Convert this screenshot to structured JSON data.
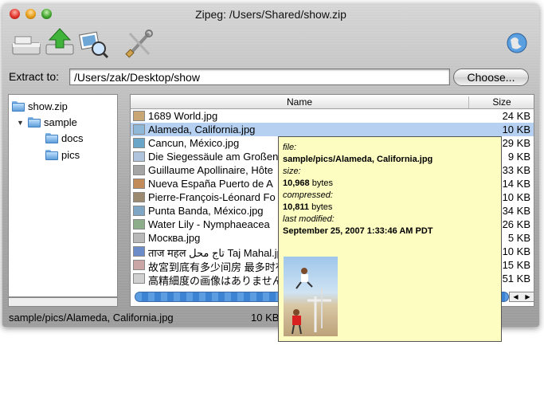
{
  "window": {
    "title": "Zipeg: /Users/Shared/show.zip"
  },
  "toolbar": {
    "buttons": [
      "drive-icon",
      "extract-up-icon",
      "preview-photos-icon",
      "tools-icon",
      "globe-icon"
    ]
  },
  "extract": {
    "label": "Extract to:",
    "path": "/Users/zak/Desktop/show",
    "choose_label": "Choose..."
  },
  "tree": {
    "items": [
      {
        "label": "show.zip",
        "level": 0,
        "expanded": false
      },
      {
        "label": "sample",
        "level": 1,
        "expanded": true
      },
      {
        "label": "docs",
        "level": 2
      },
      {
        "label": "pics",
        "level": 2
      }
    ]
  },
  "table": {
    "headers": {
      "name": "Name",
      "size": "Size"
    },
    "rows": [
      {
        "name": "1689 World.jpg",
        "size": "24 KB"
      },
      {
        "name": "Alameda, California.jpg",
        "size": "10 KB",
        "selected": true
      },
      {
        "name": "Cancun, México.jpg",
        "size": "29 KB"
      },
      {
        "name": "Die Siegessäule am Großen",
        "size": "9 KB"
      },
      {
        "name": "Guillaume Apollinaire, Hôte",
        "size": "33 KB"
      },
      {
        "name": "Nueva España Puerto de A",
        "size": "14 KB"
      },
      {
        "name": "Pierre-François-Léonard Fo",
        "size": "10 KB"
      },
      {
        "name": "Punta Banda, México.jpg",
        "size": "34 KB"
      },
      {
        "name": "Water Lily - Nymphaeacea",
        "size": "26 KB"
      },
      {
        "name": "Москва.jpg",
        "size": "5 KB"
      },
      {
        "name": "ताज महल تاج محل Taj Mahal.jp",
        "size": "10 KB"
      },
      {
        "name": "故宮到底有多少间房 最多时有",
        "size": "15 KB"
      },
      {
        "name": "高精細度の画像はありませんか",
        "size": "51 KB"
      }
    ]
  },
  "status": {
    "path": "sample/pics/Alameda, California.jpg",
    "size": "10 KB"
  },
  "popup": {
    "file_label": "file:",
    "file_value": "sample/pics/Alameda, California.jpg",
    "size_label": "size:",
    "size_value": "10,968",
    "size_unit": "bytes",
    "compressed_label": "compressed:",
    "compressed_value": "10,811",
    "compressed_unit": "bytes",
    "modified_label": "last modified:",
    "modified_value": "September 25, 2007 1:33:46 AM PDT"
  },
  "colors": {
    "selection": "#b5d0f0",
    "tooltip_bg": "#fdfdc2",
    "progress": "#3d83d3"
  }
}
